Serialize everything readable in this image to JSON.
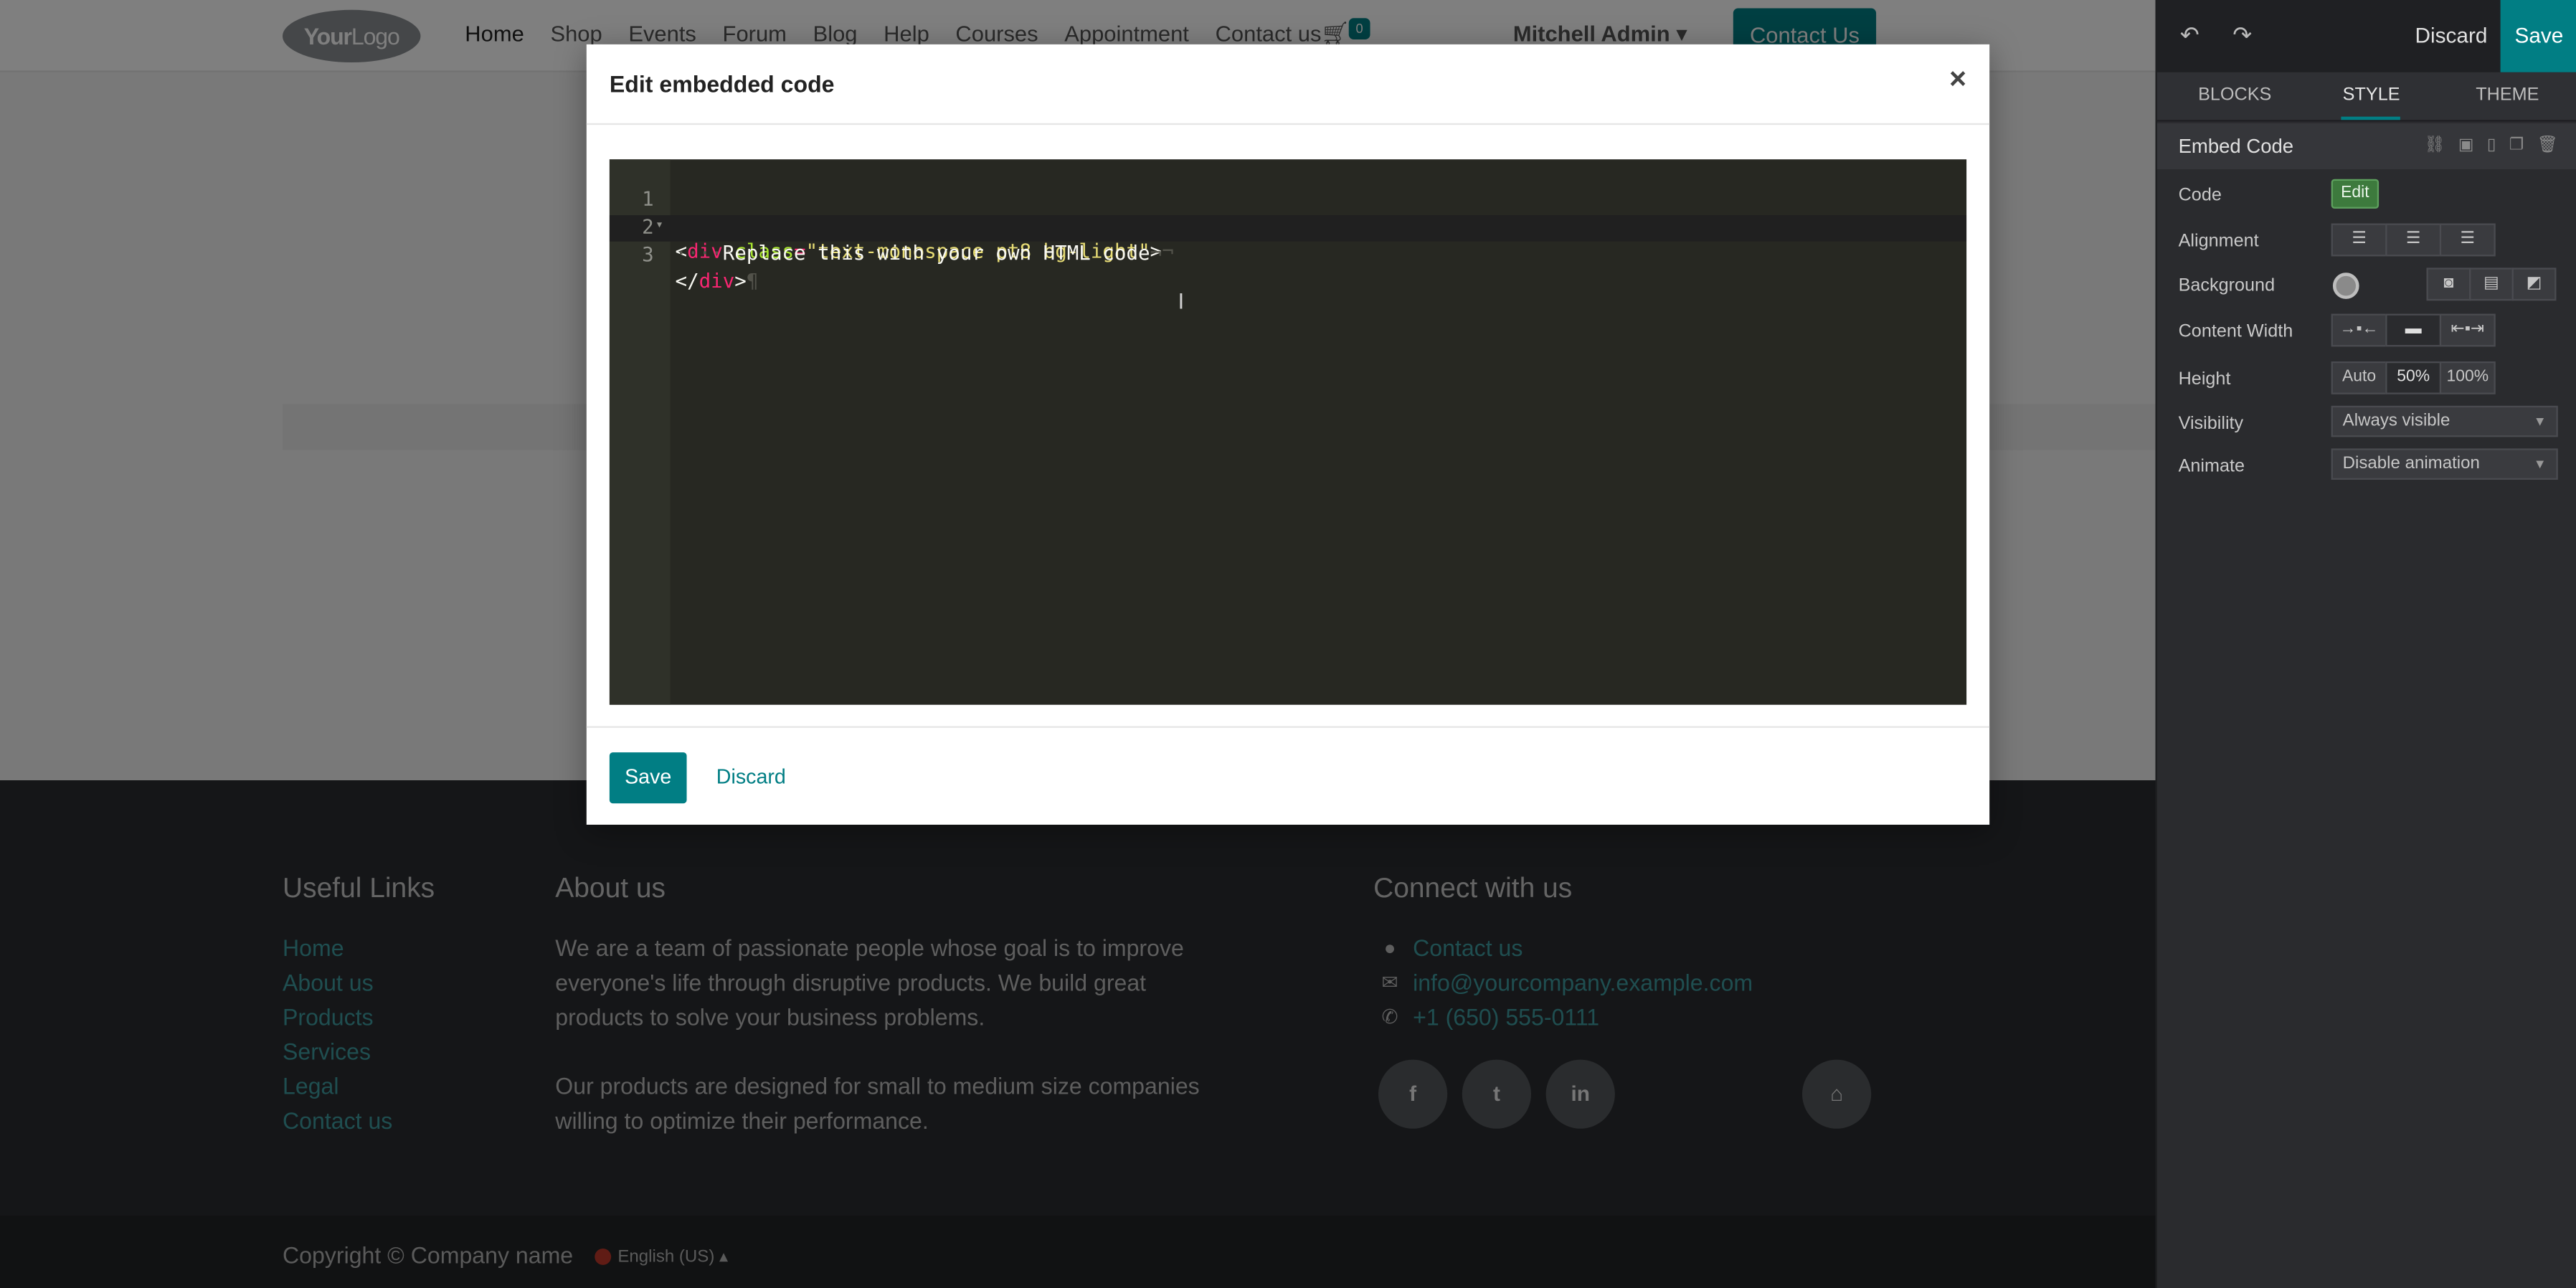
{
  "site": {
    "logo": {
      "bold": "Your",
      "thin": "Logo"
    },
    "menu": [
      "Home",
      "Shop",
      "Events",
      "Forum",
      "Blog",
      "Help",
      "Courses",
      "Appointment",
      "Contact us"
    ],
    "cart_count": "0",
    "user": "Mitchell Admin",
    "cta": "Contact Us"
  },
  "footer": {
    "useful_links_title": "Useful Links",
    "useful_links": [
      "Home",
      "About us",
      "Products",
      "Services",
      "Legal",
      "Contact us"
    ],
    "about_title": "About us",
    "about_p1": "We are a team of passionate people whose goal is to improve everyone's life through disruptive products. We build great products to solve your business problems.",
    "about_p2": "Our products are designed for small to medium size companies willing to optimize their performance.",
    "connect_title": "Connect with us",
    "contact_link": "Contact us",
    "email": "info@yourcompany.example.com",
    "phone": "+1 (650) 555-0111",
    "social": [
      "f",
      "t",
      "in"
    ],
    "copyright": "Copyright © Company name",
    "language": "English (US)"
  },
  "dialog": {
    "title": "Edit embedded code",
    "close": "×",
    "code_lines": [
      {
        "num": "1",
        "fold": "▾"
      },
      {
        "num": "2",
        "fold": ""
      },
      {
        "num": "3",
        "fold": ""
      }
    ],
    "code": {
      "l1": {
        "open": "<",
        "tag": "div",
        "attr": "class",
        "eq": "=",
        "val": "\"text-monospace pt8 bg-light\"",
        "close": ">",
        "eol": "¬"
      },
      "l2": {
        "indent": "····",
        "text": "Replace this with your own HTML code",
        "eol": "¬"
      },
      "l3": {
        "open": "</",
        "tag": "div",
        "close": ">",
        "eol": "¶"
      }
    },
    "save": "Save",
    "discard": "Discard"
  },
  "panel": {
    "discard": "Discard",
    "save": "Save",
    "tabs": [
      "BLOCKS",
      "STYLE",
      "THEME"
    ],
    "active_tab": "STYLE",
    "snippet_title": "Embed Code",
    "rows": {
      "code": "Code",
      "edit": "Edit",
      "alignment": "Alignment",
      "background": "Background",
      "content_width": "Content Width",
      "height": "Height",
      "height_opts": [
        "Auto",
        "50%",
        "100%"
      ],
      "visibility": "Visibility",
      "visibility_val": "Always visible",
      "animate": "Animate",
      "animate_val": "Disable animation"
    }
  },
  "colors": {
    "accent": "#017e84",
    "editor_bg": "#272822"
  }
}
